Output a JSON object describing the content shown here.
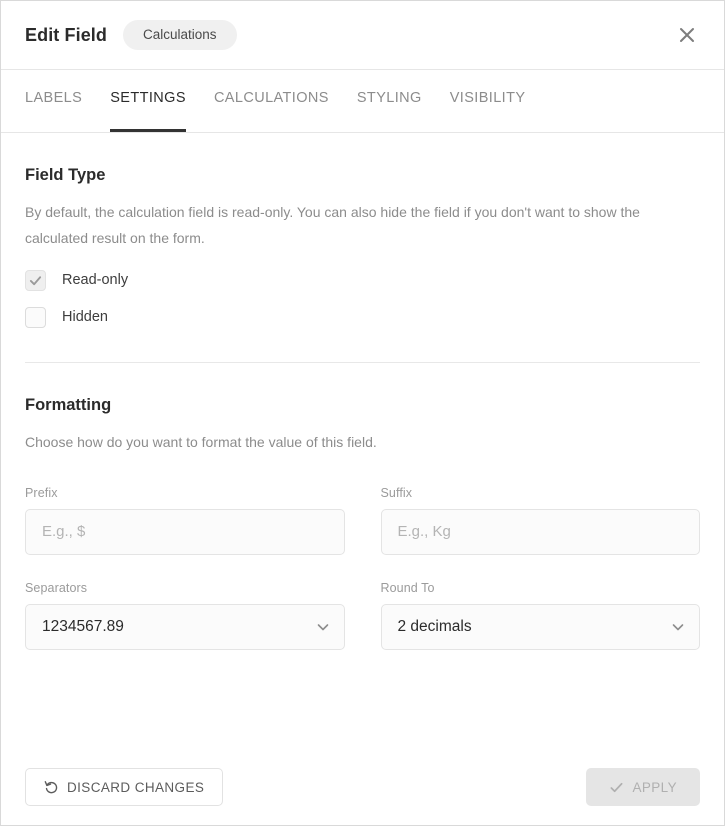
{
  "header": {
    "title": "Edit Field",
    "chip": "Calculations",
    "close_icon": "close-icon"
  },
  "tabs": [
    {
      "label": "LABELS",
      "active": false
    },
    {
      "label": "SETTINGS",
      "active": true
    },
    {
      "label": "CALCULATIONS",
      "active": false
    },
    {
      "label": "STYLING",
      "active": false
    },
    {
      "label": "VISIBILITY",
      "active": false
    }
  ],
  "field_type": {
    "title": "Field Type",
    "description": "By default, the calculation field is read-only. You can also hide the field if you don't want to show the calculated result on the form.",
    "options": [
      {
        "label": "Read-only",
        "checked": true
      },
      {
        "label": "Hidden",
        "checked": false
      }
    ]
  },
  "formatting": {
    "title": "Formatting",
    "description": "Choose how do you want to format the value of this field.",
    "prefix": {
      "label": "Prefix",
      "value": "",
      "placeholder": "E.g., $"
    },
    "suffix": {
      "label": "Suffix",
      "value": "",
      "placeholder": "E.g., Kg"
    },
    "separators": {
      "label": "Separators",
      "value": "1234567.89",
      "caret_icon": "chevron-down-icon"
    },
    "round_to": {
      "label": "Round To",
      "value": "2 decimals",
      "caret_icon": "chevron-down-icon"
    }
  },
  "footer": {
    "discard_label": "DISCARD CHANGES",
    "discard_icon": "undo-icon",
    "apply_label": "APPLY",
    "apply_icon": "check-icon",
    "apply_disabled": true
  },
  "colors": {
    "accent": "#333333",
    "text_primary": "#2b2b2b",
    "text_muted": "#8c8c8c",
    "border": "#e4e4e4",
    "field_bg": "#fbfbfb",
    "chip_bg": "#f0f0f0",
    "disabled_bg": "#e5e5e5",
    "disabled_text": "#b0b0b0"
  }
}
